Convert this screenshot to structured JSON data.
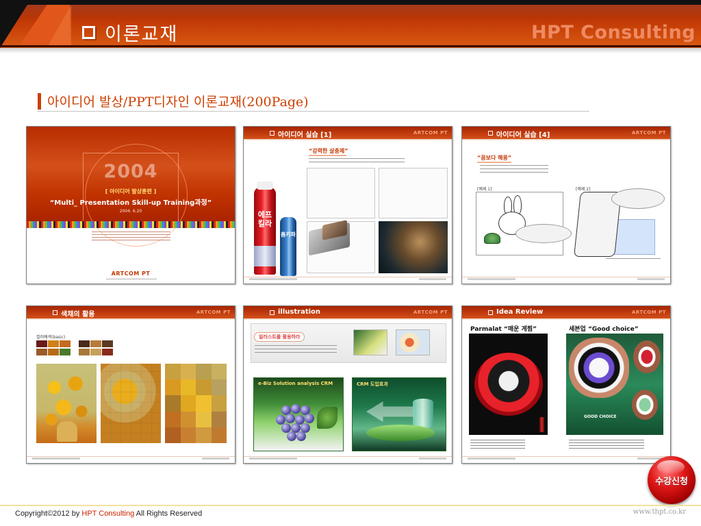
{
  "header": {
    "title": "이론교재",
    "brand": "HPT Consulting",
    "checkbox_icon": "checkbox-square-icon"
  },
  "subtitle": "아이디어 발상/PPT디자인 이론교재(200Page)",
  "thumbnails": [
    {
      "kind": "cover",
      "year": "2004",
      "tag": "[ 아이디어 발상훈련 ]",
      "title": "“Multi_ Presentation Skill-up Training과정”",
      "date": "2004. 6.20",
      "brand": "ARTCOM PT"
    },
    {
      "kind": "slide",
      "bar_label": "아이디어 실습 [1]",
      "bar_brand": "ARTCOM PT",
      "heading": "“강력한 살충제”",
      "can_label": "에프\n킬라",
      "can2_label": "홈키파"
    },
    {
      "kind": "slide",
      "bar_label": "아이디어 실습 [4]",
      "bar_brand": "ARTCOM PT",
      "heading": "“꿈보다 해몽”",
      "example_a": "[예제 1]",
      "example_b": "[예제 2]"
    },
    {
      "kind": "slide",
      "bar_label": "색채의 활용",
      "bar_brand": "ARTCOM PT",
      "palette_label": "컬러배색(basic)"
    },
    {
      "kind": "slide",
      "bar_label": "illustration",
      "bar_brand": "ARTCOM PT",
      "pill": "일러스트를 활용하라",
      "panel_a_head": "e-Biz Solution analysis  CRM",
      "panel_b_head": "CRM 도입효과"
    },
    {
      "kind": "slide",
      "bar_label": "Idea Review",
      "bar_brand": "ARTCOM PT",
      "ad_a_title": "Parmalat “매운 게찜”",
      "ad_b_title": "세븐업 “Good choice”",
      "ad_b_tag": "GOOD CHOICE"
    }
  ],
  "badge": {
    "label": "수강신청"
  },
  "footer": {
    "copyright_prefix": "Copyright©2012 by ",
    "copyright_brand": "HPT Consulting",
    "copyright_suffix": " All Rights Reserved",
    "url": "www.thpt.co.kr"
  },
  "colors": {
    "header_red": "#c23a06",
    "accent": "#cc3f00",
    "brand_light": "#ef8a63",
    "badge_red": "#e01818"
  }
}
